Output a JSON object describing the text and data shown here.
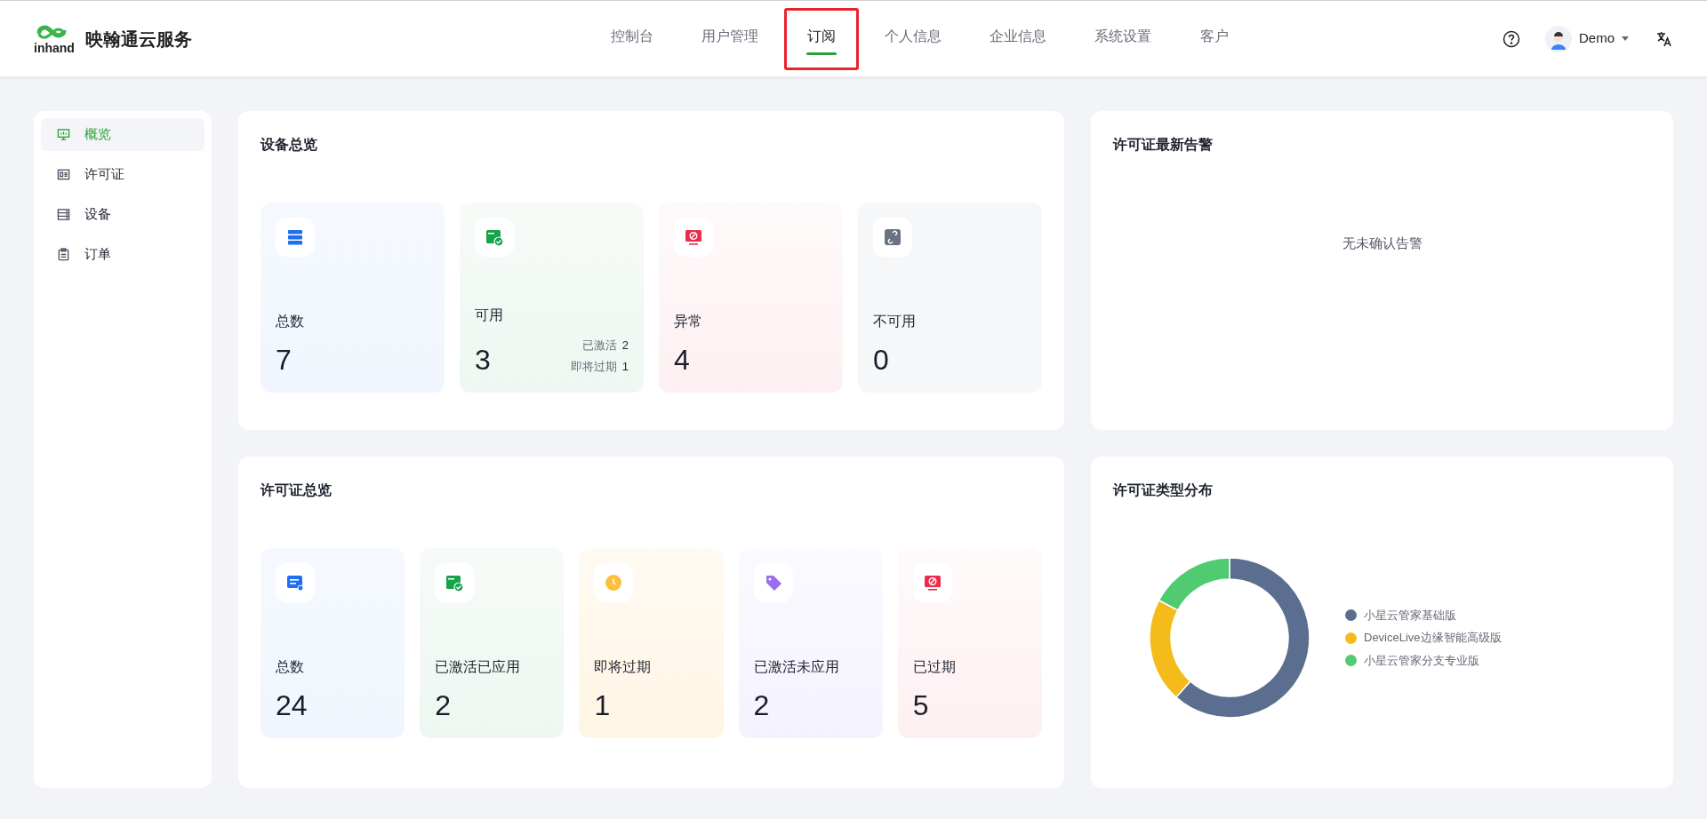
{
  "header": {
    "brand": "映翰通云服务",
    "logo_text": "inhand",
    "user": "Demo"
  },
  "nav": [
    {
      "label": "控制台",
      "selected": false,
      "highlighted": false
    },
    {
      "label": "用户管理",
      "selected": false,
      "highlighted": false
    },
    {
      "label": "订阅",
      "selected": true,
      "highlighted": true
    },
    {
      "label": "个人信息",
      "selected": false,
      "highlighted": false
    },
    {
      "label": "企业信息",
      "selected": false,
      "highlighted": false
    },
    {
      "label": "系统设置",
      "selected": false,
      "highlighted": false
    },
    {
      "label": "客户",
      "selected": false,
      "highlighted": false
    }
  ],
  "sidebar": {
    "items": [
      {
        "label": "概览",
        "kind": "monitor",
        "selected": true
      },
      {
        "label": "许可证",
        "kind": "card",
        "selected": false
      },
      {
        "label": "设备",
        "kind": "server",
        "selected": false
      },
      {
        "label": "订单",
        "kind": "clipboard",
        "selected": false
      }
    ]
  },
  "device_overview": {
    "title": "设备总览",
    "cards": [
      {
        "kind": "total",
        "label": "总数",
        "value": "7"
      },
      {
        "kind": "available",
        "label": "可用",
        "value": "3",
        "details": [
          {
            "label": "已激活",
            "value": "2"
          },
          {
            "label": "即将过期",
            "value": "1"
          }
        ]
      },
      {
        "kind": "abnormal",
        "label": "异常",
        "value": "4"
      },
      {
        "kind": "unavailable",
        "label": "不可用",
        "value": "0"
      }
    ]
  },
  "alerts": {
    "title": "许可证最新告警",
    "empty_text": "无未确认告警"
  },
  "license_overview": {
    "title": "许可证总览",
    "cards": [
      {
        "kind": "license",
        "label": "总数",
        "value": "24"
      },
      {
        "kind": "available",
        "label": "已激活已应用",
        "value": "2"
      },
      {
        "kind": "expiring",
        "label": "即将过期",
        "value": "1"
      },
      {
        "kind": "tag",
        "label": "已激活未应用",
        "value": "2"
      },
      {
        "kind": "abnormal",
        "label": "已过期",
        "value": "5"
      }
    ]
  },
  "distribution": {
    "title": "许可证类型分布",
    "legend": [
      {
        "label": "小星云管家基础版",
        "color": "#5b6e90"
      },
      {
        "label": "DeviceLive边缘智能高级版",
        "color": "#f5bb1b"
      },
      {
        "label": "小星云管家分支专业版",
        "color": "#50cb6f"
      }
    ]
  }
}
